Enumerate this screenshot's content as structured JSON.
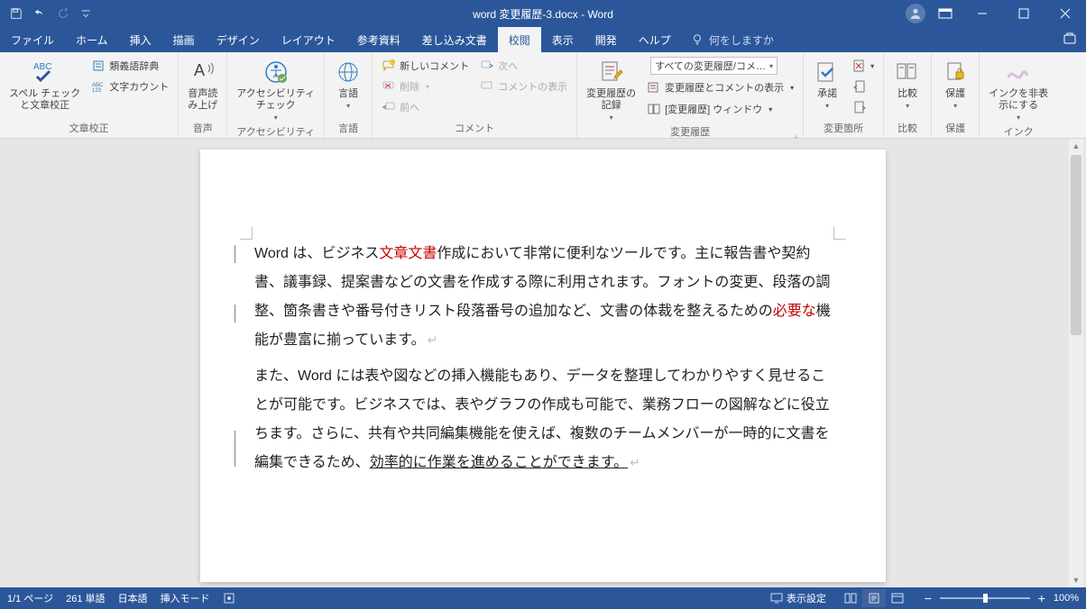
{
  "titlebar": {
    "title": "word 変更履歴-3.docx - Word"
  },
  "tabs": {
    "file": "ファイル",
    "home": "ホーム",
    "insert": "挿入",
    "draw": "描画",
    "design": "デザイン",
    "layout": "レイアウト",
    "references": "参考資料",
    "mailings": "差し込み文書",
    "review": "校閲",
    "view": "表示",
    "developer": "開発",
    "help": "ヘルプ",
    "tellme": "何をしますか"
  },
  "ribbon": {
    "proofing": {
      "label": "文章校正",
      "spellcheck": "スペル チェック\nと文章校正",
      "thesaurus": "類義語辞典",
      "wordcount": "文字カウント"
    },
    "speech": {
      "label": "音声",
      "readaloud": "音声読\nみ上げ"
    },
    "accessibility": {
      "label": "アクセシビリティ",
      "check": "アクセシビリティ\nチェック"
    },
    "language": {
      "label": "言語",
      "btn": "言語"
    },
    "comments": {
      "label": "コメント",
      "new": "新しいコメント",
      "delete": "削除",
      "prev": "前へ",
      "next": "次へ",
      "show": "コメントの表示"
    },
    "tracking": {
      "label": "変更履歴",
      "track": "変更履歴の\n記録",
      "dd1": "すべての変更履歴/コメ…",
      "dd2": "変更履歴とコメントの表示",
      "dd3": "[変更履歴] ウィンドウ"
    },
    "changes": {
      "label": "変更箇所",
      "accept": "承諾"
    },
    "compare": {
      "label": "比較",
      "btn": "比較"
    },
    "protect": {
      "label": "保護",
      "btn": "保護"
    },
    "ink": {
      "label": "インク",
      "btn": "インクを非表\n示にする"
    }
  },
  "document": {
    "p1_a": "Word は、ビジネス",
    "p1_b": "文章文書",
    "p1_c": "作成において非常に便利なツールです。主に報告書や契約書、議事録、提案書などの文書を作成する際に利用されます。フォントの変更、段落の調整、箇条書きや番号付きリスト段落番号の追加など、文書の体裁を整えるための",
    "p1_d": "必要な",
    "p1_e": "機能が豊富に揃っています。",
    "p2_a": "また、Word には表や図などの挿入機能もあり、データを整理してわかりやすく見せることが可能です。ビジネスでは、表やグラフの作成も可能で、業務フローの図解などに役立ちます。さらに、共有や共同編集機能を使えば、複数のチームメンバーが一時的に文書を編集できるため、",
    "p2_b": "効率的に作業を進めることができます。"
  },
  "statusbar": {
    "page": "1/1 ページ",
    "words": "261 単語",
    "lang": "日本語",
    "insert": "挿入モード",
    "display": "表示設定",
    "zoom": "100%"
  }
}
